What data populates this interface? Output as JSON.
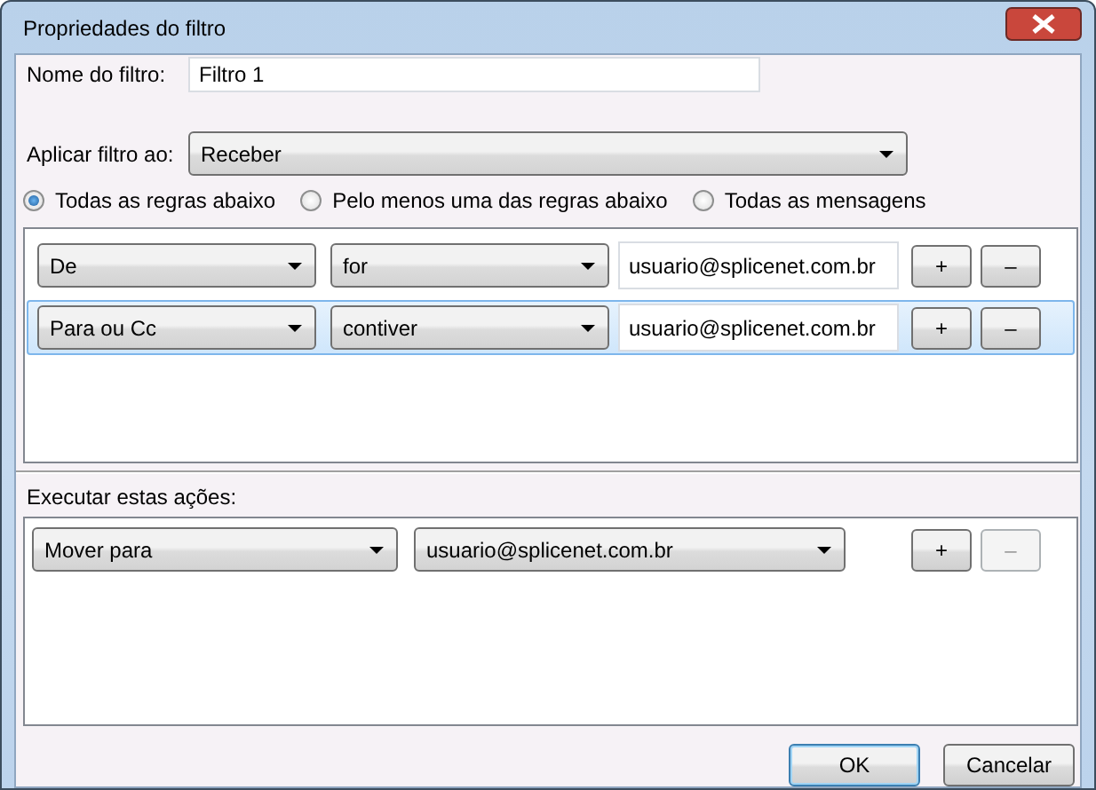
{
  "window": {
    "title": "Propriedades do filtro"
  },
  "filter_name": {
    "label": "Nome do filtro:",
    "value": "Filtro 1"
  },
  "apply_to": {
    "label": "Aplicar filtro ao:",
    "value": "Receber"
  },
  "match_options": [
    {
      "label": "Todas as regras abaixo",
      "selected": true
    },
    {
      "label": "Pelo menos uma das regras abaixo",
      "selected": false
    },
    {
      "label": "Todas as mensagens",
      "selected": false
    }
  ],
  "rules": [
    {
      "field": "De",
      "operator": "for",
      "value": "usuario@splicenet.com.br",
      "selected": false,
      "add": {
        "label": "+",
        "disabled": false
      },
      "remove": {
        "label": "–",
        "disabled": false
      }
    },
    {
      "field": "Para ou Cc",
      "operator": "contiver",
      "value": "usuario@splicenet.com.br",
      "selected": true,
      "add": {
        "label": "+",
        "disabled": false
      },
      "remove": {
        "label": "–",
        "disabled": false
      }
    }
  ],
  "actions_label": "Executar estas ações:",
  "actions": [
    {
      "action": "Mover para",
      "target": "usuario@splicenet.com.br",
      "add": {
        "label": "+",
        "disabled": false
      },
      "remove": {
        "label": "–",
        "disabled": true
      }
    }
  ],
  "buttons": [
    {
      "label": "OK",
      "default": true
    },
    {
      "label": "Cancelar",
      "default": false
    }
  ]
}
